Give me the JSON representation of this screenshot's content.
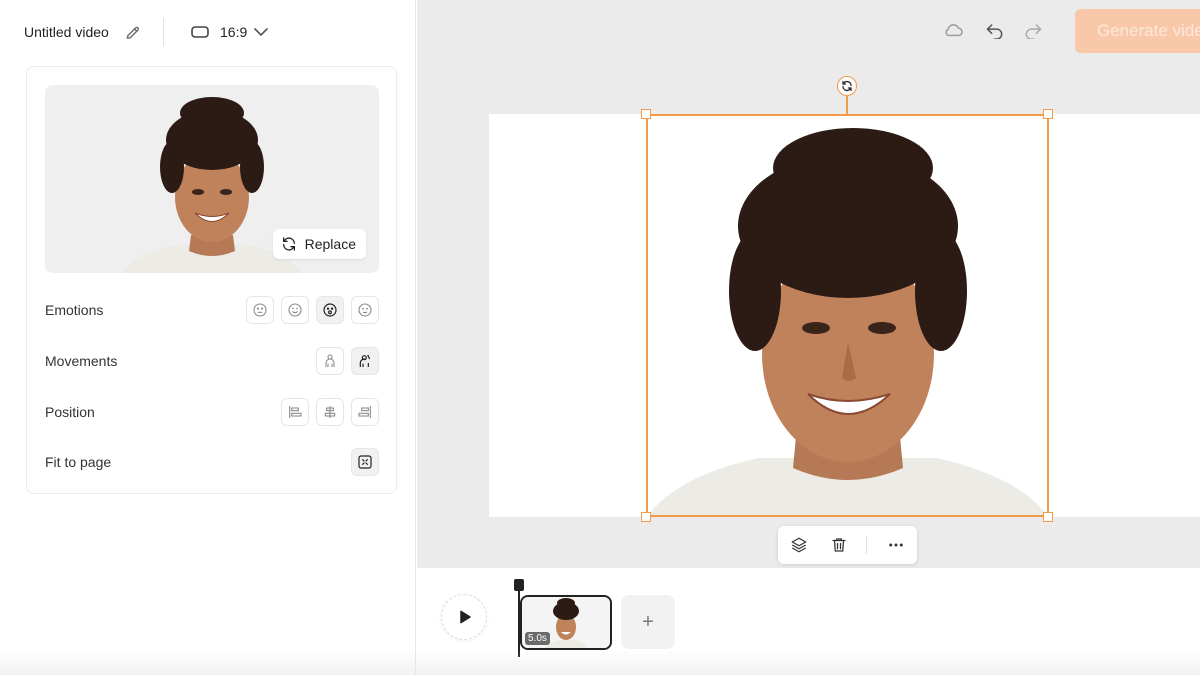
{
  "header": {
    "title": "Untitled video",
    "aspect_ratio": "16:9",
    "edit_icon": "pencil-icon",
    "ratio_icon": "aspect-rect-icon"
  },
  "avatar_panel": {
    "replace_label": "Replace",
    "rows": [
      {
        "label": "Emotions",
        "icons": [
          "emotion-neutral-icon",
          "emotion-happy-icon",
          "emotion-surprised-icon",
          "emotion-calm-icon"
        ],
        "active": 2
      },
      {
        "label": "Movements",
        "icons": [
          "movement-still-icon",
          "movement-wave-icon"
        ],
        "active": 1
      },
      {
        "label": "Position",
        "icons": [
          "align-left-icon",
          "align-center-icon",
          "align-right-icon"
        ],
        "active": -1
      },
      {
        "label": "Fit to page",
        "icons": [
          "fit-to-page-icon"
        ],
        "active": 0
      }
    ]
  },
  "toolbar": {
    "generate_label": "Generate video",
    "icons": [
      "cloud-save-icon",
      "undo-icon",
      "redo-icon"
    ]
  },
  "canvas": {
    "floating_toolbar_icons": [
      "layers-icon",
      "trash-icon",
      "more-icon"
    ],
    "rotate_icon": "rotate-icon"
  },
  "timeline": {
    "clip_duration": "5.0s",
    "add_label": "+",
    "play_icon": "play-icon"
  },
  "colors": {
    "accent": "#f09a4a",
    "generate_bg": "#f8c8a8"
  }
}
